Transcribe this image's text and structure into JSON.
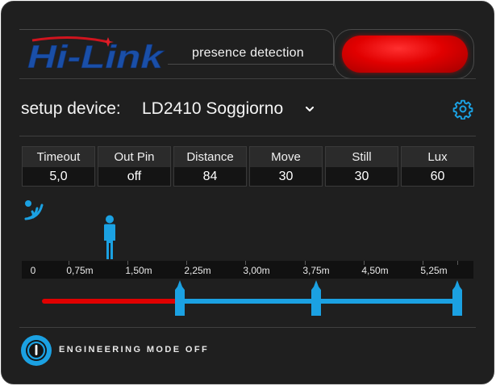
{
  "header": {
    "logo_text": "Hi-Link",
    "subtitle": "presence detection",
    "presence_state": "active"
  },
  "device": {
    "label": "setup device:",
    "selected": "LD2410 Soggiorno"
  },
  "stats": [
    {
      "label": "Timeout",
      "value": "5,0"
    },
    {
      "label": "Out Pin",
      "value": "off"
    },
    {
      "label": "Distance",
      "value": "84"
    },
    {
      "label": "Move",
      "value": "30"
    },
    {
      "label": "Still",
      "value": "30"
    },
    {
      "label": "Lux",
      "value": "60"
    }
  ],
  "ruler": {
    "ticks": [
      "0",
      "0,75m",
      "1,50m",
      "2,25m",
      "3,00m",
      "3,75m",
      "4,50m",
      "5,25m"
    ]
  },
  "range": {
    "max_m": 6.0,
    "person_m": 0.84,
    "gates_m": [
      2.25,
      3.75,
      5.85
    ]
  },
  "engineering": {
    "label": "ENGINEERING MODE OFF",
    "enabled": false
  },
  "colors": {
    "accent": "#1ba1e2",
    "active_red": "#e00000",
    "background": "#1f1f1f"
  }
}
